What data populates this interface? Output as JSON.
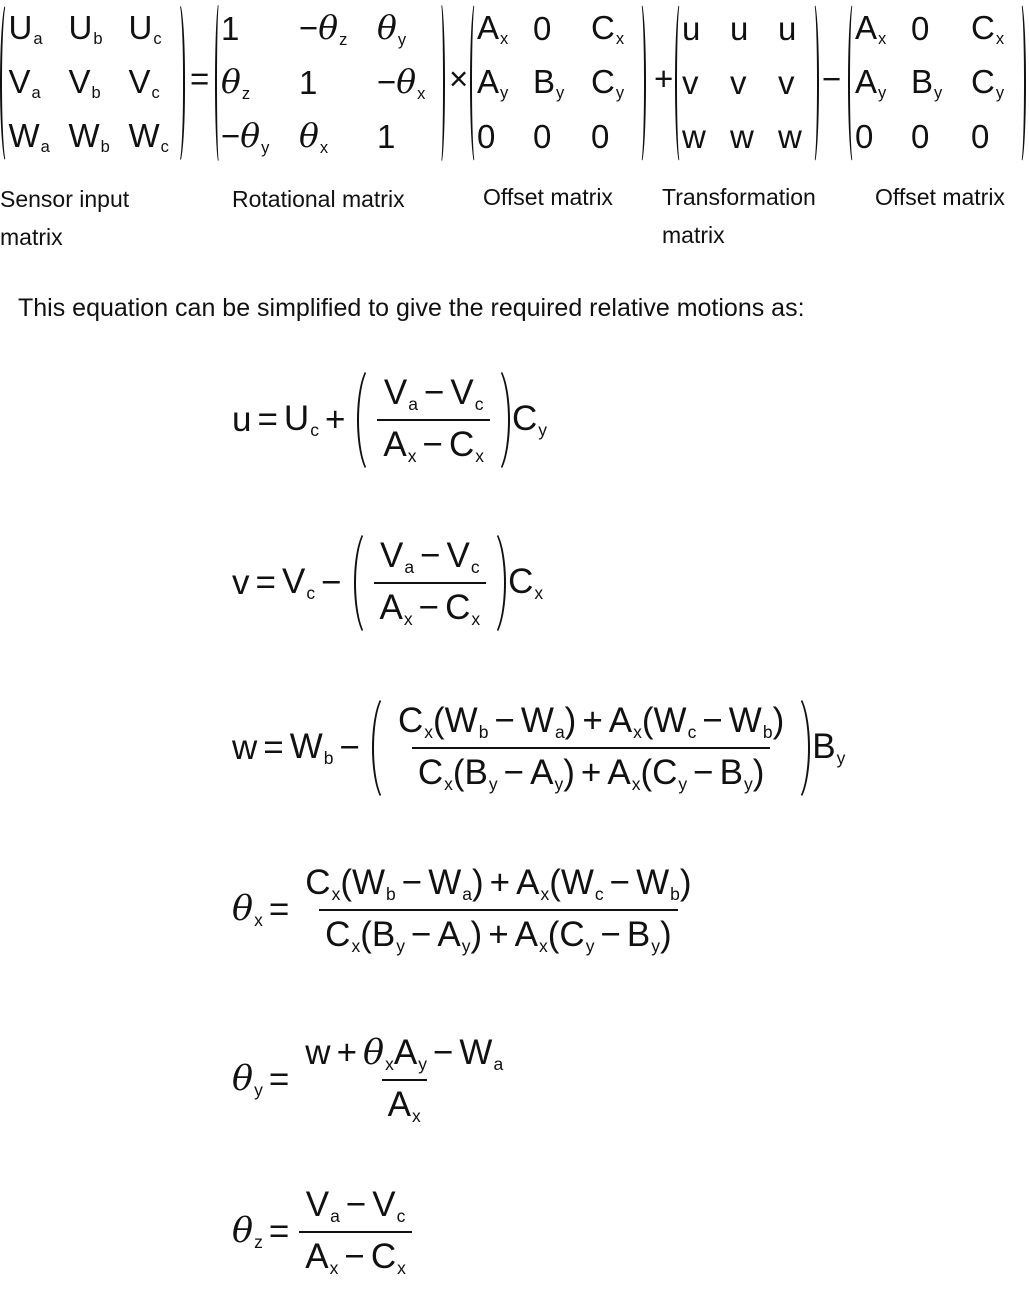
{
  "matrix_equation": {
    "matrices": [
      {
        "rows": [
          [
            "U_a",
            "U_b",
            "U_c"
          ],
          [
            "V_a",
            "V_b",
            "V_c"
          ],
          [
            "W_a",
            "W_b",
            "W_c"
          ]
        ],
        "label": "Sensor input matrix"
      },
      {
        "rows": [
          [
            "1",
            "−θ_z",
            "θ_y"
          ],
          [
            "θ_z",
            "1",
            "−θ_x"
          ],
          [
            "−θ_y",
            "θ_x",
            "1"
          ]
        ],
        "label": "Rotational matrix"
      },
      {
        "rows": [
          [
            "A_x",
            "0",
            "C_x"
          ],
          [
            "A_y",
            "B_y",
            "C_y"
          ],
          [
            "0",
            "0",
            "0"
          ]
        ],
        "label": "Offset matrix"
      },
      {
        "rows": [
          [
            "u",
            "u",
            "u"
          ],
          [
            "v",
            "v",
            "v"
          ],
          [
            "w",
            "w",
            "w"
          ]
        ],
        "label": "Transformation matrix"
      },
      {
        "rows": [
          [
            "A_x",
            "0",
            "C_x"
          ],
          [
            "A_y",
            "B_y",
            "C_y"
          ],
          [
            "0",
            "0",
            "0"
          ]
        ],
        "label": "Offset matrix"
      }
    ],
    "operators": [
      "=",
      "×",
      "+",
      "−"
    ]
  },
  "sentence": "This equation can be simplified to give the required relative motions as:",
  "equations": [
    {
      "lhs": [
        "u",
        "=",
        "U_c",
        "+"
      ],
      "paren": true,
      "num": [
        "V_a",
        "−",
        "V_c"
      ],
      "den": [
        "A_x",
        "−",
        "C_x"
      ],
      "after": [
        "C_y"
      ]
    },
    {
      "lhs": [
        "v",
        "=",
        "V_c",
        "−"
      ],
      "paren": true,
      "num": [
        "V_a",
        "−",
        "V_c"
      ],
      "den": [
        "A_x",
        "−",
        "C_x"
      ],
      "after": [
        "C_x"
      ]
    },
    {
      "lhs": [
        "w",
        "=",
        "W_b",
        "−"
      ],
      "paren": true,
      "num": [
        "C_x",
        "(",
        "W_b",
        "−",
        "W_a",
        ")",
        "+",
        "A_x",
        "(",
        "W_c",
        "−",
        "W_b",
        ")"
      ],
      "den": [
        "C_x",
        "(",
        "B_y",
        "−",
        "A_y",
        ")",
        "+",
        "A_x",
        "(",
        "C_y",
        "−",
        "B_y",
        ")"
      ],
      "after": [
        "B_y"
      ]
    },
    {
      "lhs": [
        "θ_x",
        "="
      ],
      "paren": false,
      "num": [
        "C_x",
        "(",
        "W_b",
        "−",
        "W_a",
        ")",
        "+",
        "A_x",
        "(",
        "W_c",
        "−",
        "W_b",
        ")"
      ],
      "den": [
        "C_x",
        "(",
        "B_y",
        "−",
        "A_y",
        ")",
        "+",
        "A_x",
        "(",
        "C_y",
        "−",
        "B_y",
        ")"
      ],
      "after": []
    },
    {
      "lhs": [
        "θ_y",
        "="
      ],
      "paren": false,
      "num": [
        "w",
        "+",
        "θ_x",
        "A_y",
        "−",
        "W_a"
      ],
      "den": [
        "A_x"
      ],
      "after": []
    },
    {
      "lhs": [
        "θ_z",
        "="
      ],
      "paren": false,
      "num": [
        "V_a",
        "−",
        "V_c"
      ],
      "den": [
        "A_x",
        "−",
        "C_x"
      ],
      "after": []
    }
  ]
}
